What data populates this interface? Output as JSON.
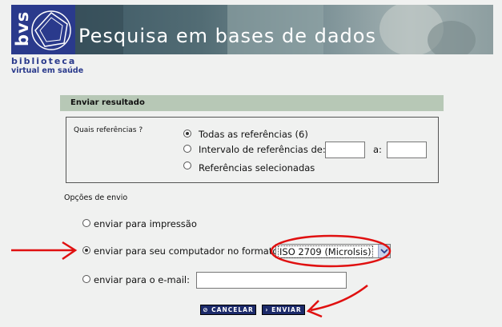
{
  "header": {
    "logo_text": "bvs",
    "banner_title": "Pesquisa em bases de dados",
    "biblioteca": "biblioteca",
    "virtual": "virtual em saúde"
  },
  "section": {
    "title": "Enviar resultado"
  },
  "references": {
    "label": "Quais referências ?",
    "all": "Todas as referências (6)",
    "interval": "Intervalo de referências de:",
    "interval_to": "a:",
    "interval_from_value": "",
    "interval_to_value": "",
    "selected": "Referências selecionadas",
    "checked": "all"
  },
  "options": {
    "label": "Opções de envio",
    "print": "enviar para impressão",
    "computer": "enviar para seu computador no formato",
    "email": "enviar para o e-mail:",
    "email_value": "",
    "checked": "computer",
    "format_selected": "ISO 2709 (Microlsis)"
  },
  "buttons": {
    "cancel": "CANCELAR",
    "send": "ENVIAR",
    "cancel_icon": "cancel-icon",
    "send_icon": "arrow-right-icon"
  },
  "colors": {
    "brand": "#2a3a8c",
    "section_bar": "#b7c8b6",
    "annotation": "#e01010"
  }
}
